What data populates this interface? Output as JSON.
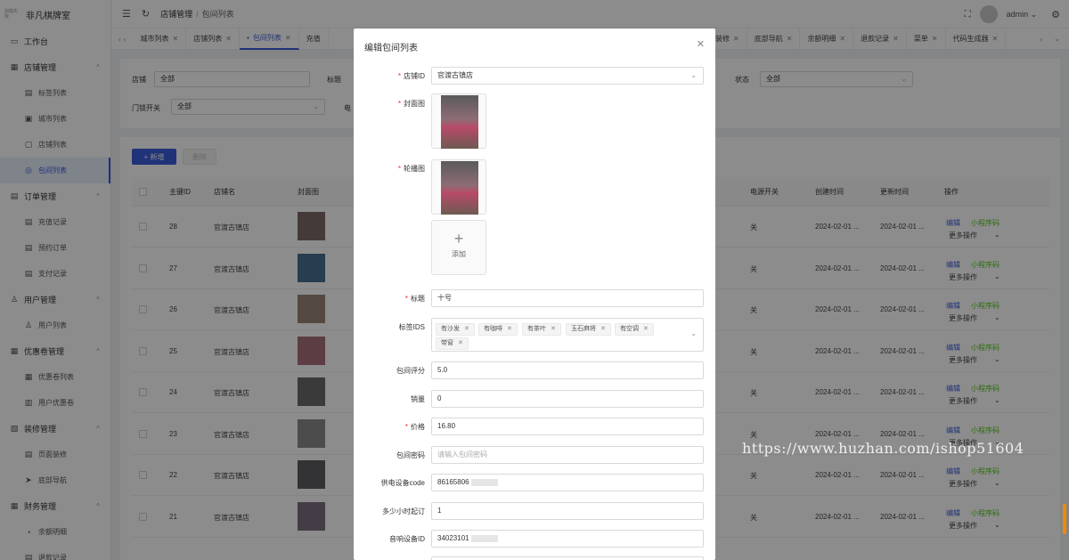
{
  "app": {
    "logo_small": "加载失败",
    "name": "非凡棋牌室"
  },
  "sidebar": [
    {
      "label": "工作台",
      "icon": "monitor-icon",
      "sub": false
    },
    {
      "label": "店铺管理",
      "icon": "grid-icon",
      "sub": false,
      "group": true
    },
    {
      "label": "标签列表",
      "icon": "doc-icon",
      "sub": true
    },
    {
      "label": "城市列表",
      "icon": "image-icon",
      "sub": true
    },
    {
      "label": "店铺列表",
      "icon": "window-icon",
      "sub": true
    },
    {
      "label": "包间列表",
      "icon": "camera-icon",
      "sub": true,
      "active": true
    },
    {
      "label": "订单管理",
      "icon": "doc-icon",
      "sub": false,
      "group": true
    },
    {
      "label": "充值记录",
      "icon": "doc-icon",
      "sub": true
    },
    {
      "label": "预约订单",
      "icon": "doc-icon",
      "sub": true
    },
    {
      "label": "支付记录",
      "icon": "doc-icon",
      "sub": true
    },
    {
      "label": "用户管理",
      "icon": "user-icon",
      "sub": false,
      "group": true
    },
    {
      "label": "用户列表",
      "icon": "user-icon",
      "sub": true
    },
    {
      "label": "优惠卷管理",
      "icon": "grid-icon",
      "sub": false,
      "group": true
    },
    {
      "label": "优惠卷列表",
      "icon": "grid-icon",
      "sub": true
    },
    {
      "label": "用户优惠卷",
      "icon": "ticket-icon",
      "sub": true
    },
    {
      "label": "装修管理",
      "icon": "brush-icon",
      "sub": false,
      "group": true
    },
    {
      "label": "页面装修",
      "icon": "doc-icon",
      "sub": true
    },
    {
      "label": "底部导航",
      "icon": "send-icon",
      "sub": true
    },
    {
      "label": "财务管理",
      "icon": "grid-icon",
      "sub": false,
      "group": true
    },
    {
      "label": "余额明细",
      "icon": "coin-icon",
      "sub": true
    },
    {
      "label": "退款记录",
      "icon": "doc-icon",
      "sub": true
    }
  ],
  "header": {
    "crumb1": "店铺管理",
    "sep": "/",
    "crumb2": "包间列表",
    "user": "admin"
  },
  "tabs": [
    {
      "label": "城市列表",
      "x": 0
    },
    {
      "label": "店铺列表"
    },
    {
      "label": "包间列表",
      "active": true
    },
    {
      "label": "充值"
    },
    {
      "label": "装修"
    },
    {
      "label": "底部导航"
    },
    {
      "label": "余额明细"
    },
    {
      "label": "退款记录"
    },
    {
      "label": "菜单"
    },
    {
      "label": "代码生成器"
    }
  ],
  "filter": {
    "shop_label": "店铺",
    "shop_value": "全部",
    "title_label": "标题",
    "status_label": "状态",
    "status_value": "全部",
    "door_label": "门锁开关",
    "door_value": "全部",
    "elec_label": "电"
  },
  "table": {
    "add": "+ 新增",
    "del": "删除",
    "headers": [
      "主键ID",
      "店铺名",
      "封面图",
      "电源开关",
      "创建时间",
      "更新时间",
      "操作"
    ],
    "rows": [
      {
        "id": "28",
        "shop": "官渡古镇店",
        "power": "关",
        "created": "2024-02-01 ...",
        "updated": "2024-02-01 ..."
      },
      {
        "id": "27",
        "shop": "官渡古镇店",
        "power": "关",
        "created": "2024-02-01 ...",
        "updated": "2024-02-01 ..."
      },
      {
        "id": "26",
        "shop": "官渡古镇店",
        "power": "关",
        "created": "2024-02-01 ...",
        "updated": "2024-02-01 ..."
      },
      {
        "id": "25",
        "shop": "官渡古镇店",
        "power": "关",
        "created": "2024-02-01 ...",
        "updated": "2024-02-01 ..."
      },
      {
        "id": "24",
        "shop": "官渡古镇店",
        "power": "关",
        "created": "2024-02-01 ...",
        "updated": "2024-02-01 ..."
      },
      {
        "id": "23",
        "shop": "官渡古镇店",
        "power": "关",
        "created": "2024-02-01 ...",
        "updated": "2024-02-01 ..."
      },
      {
        "id": "22",
        "shop": "官渡古镇店",
        "power": "关",
        "created": "2024-02-01 ...",
        "updated": "2024-02-01 ..."
      },
      {
        "id": "21",
        "shop": "官渡古镇店",
        "power": "关",
        "created": "2024-02-01 ...",
        "updated": "2024-02-01 ..."
      }
    ],
    "edit": "编辑",
    "mini": "小程序码",
    "more": "更多操作"
  },
  "modal": {
    "title": "编辑包间列表",
    "shop_label": "店铺ID",
    "shop_value": "官渡古镇店",
    "cover_label": "封面图",
    "carousel_label": "轮播图",
    "upload_text": "添加",
    "title_label": "标题",
    "title_value": "十号",
    "tags_label": "标签IDS",
    "tags": [
      "有沙发",
      "有咖啡",
      "有茶叶",
      "玉石麻将",
      "有空调",
      "带窗"
    ],
    "rating_label": "包间评分",
    "rating_value": "5.0",
    "sales_label": "销量",
    "sales_value": "0",
    "price_label": "价格",
    "price_value": "16.80",
    "pwd_label": "包间密码",
    "pwd_placeholder": "请输入包间密码",
    "power_label": "供电设备code",
    "power_value": "86165806",
    "hours_label": "多少小时起订",
    "hours_value": "1",
    "audio_label": "音响设备ID",
    "audio_value": "34023101"
  },
  "watermark": "https://www.huzhan.com/ishop51604"
}
